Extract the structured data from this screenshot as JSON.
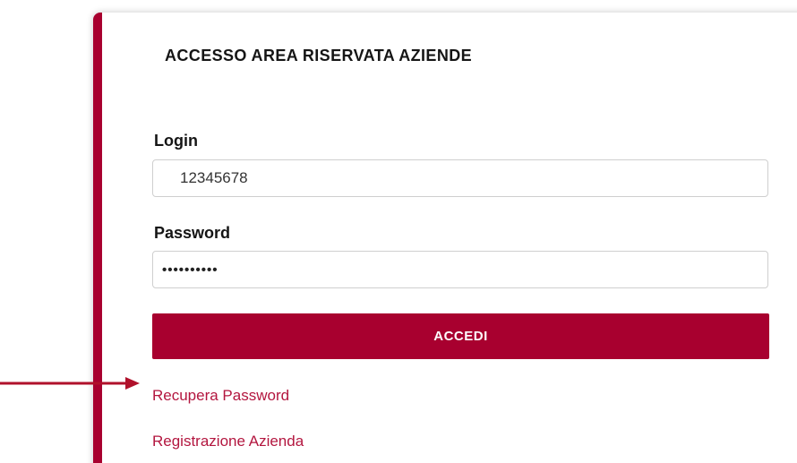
{
  "page": {
    "title": "ACCESSO AREA RISERVATA AZIENDE"
  },
  "form": {
    "login_label": "Login",
    "login_value": "12345678",
    "password_label": "Password",
    "password_value": "••••••••••",
    "submit_label": "ACCEDI"
  },
  "links": {
    "recover_password": "Recupera Password",
    "company_registration": "Registrazione Azienda"
  },
  "annotation": {
    "arrow_target": "Recupera Password"
  },
  "colors": {
    "accent": "#a8002f",
    "link": "#b3163f",
    "arrow": "#b0112b",
    "text": "#151515",
    "input_border": "#cfcfcf"
  }
}
